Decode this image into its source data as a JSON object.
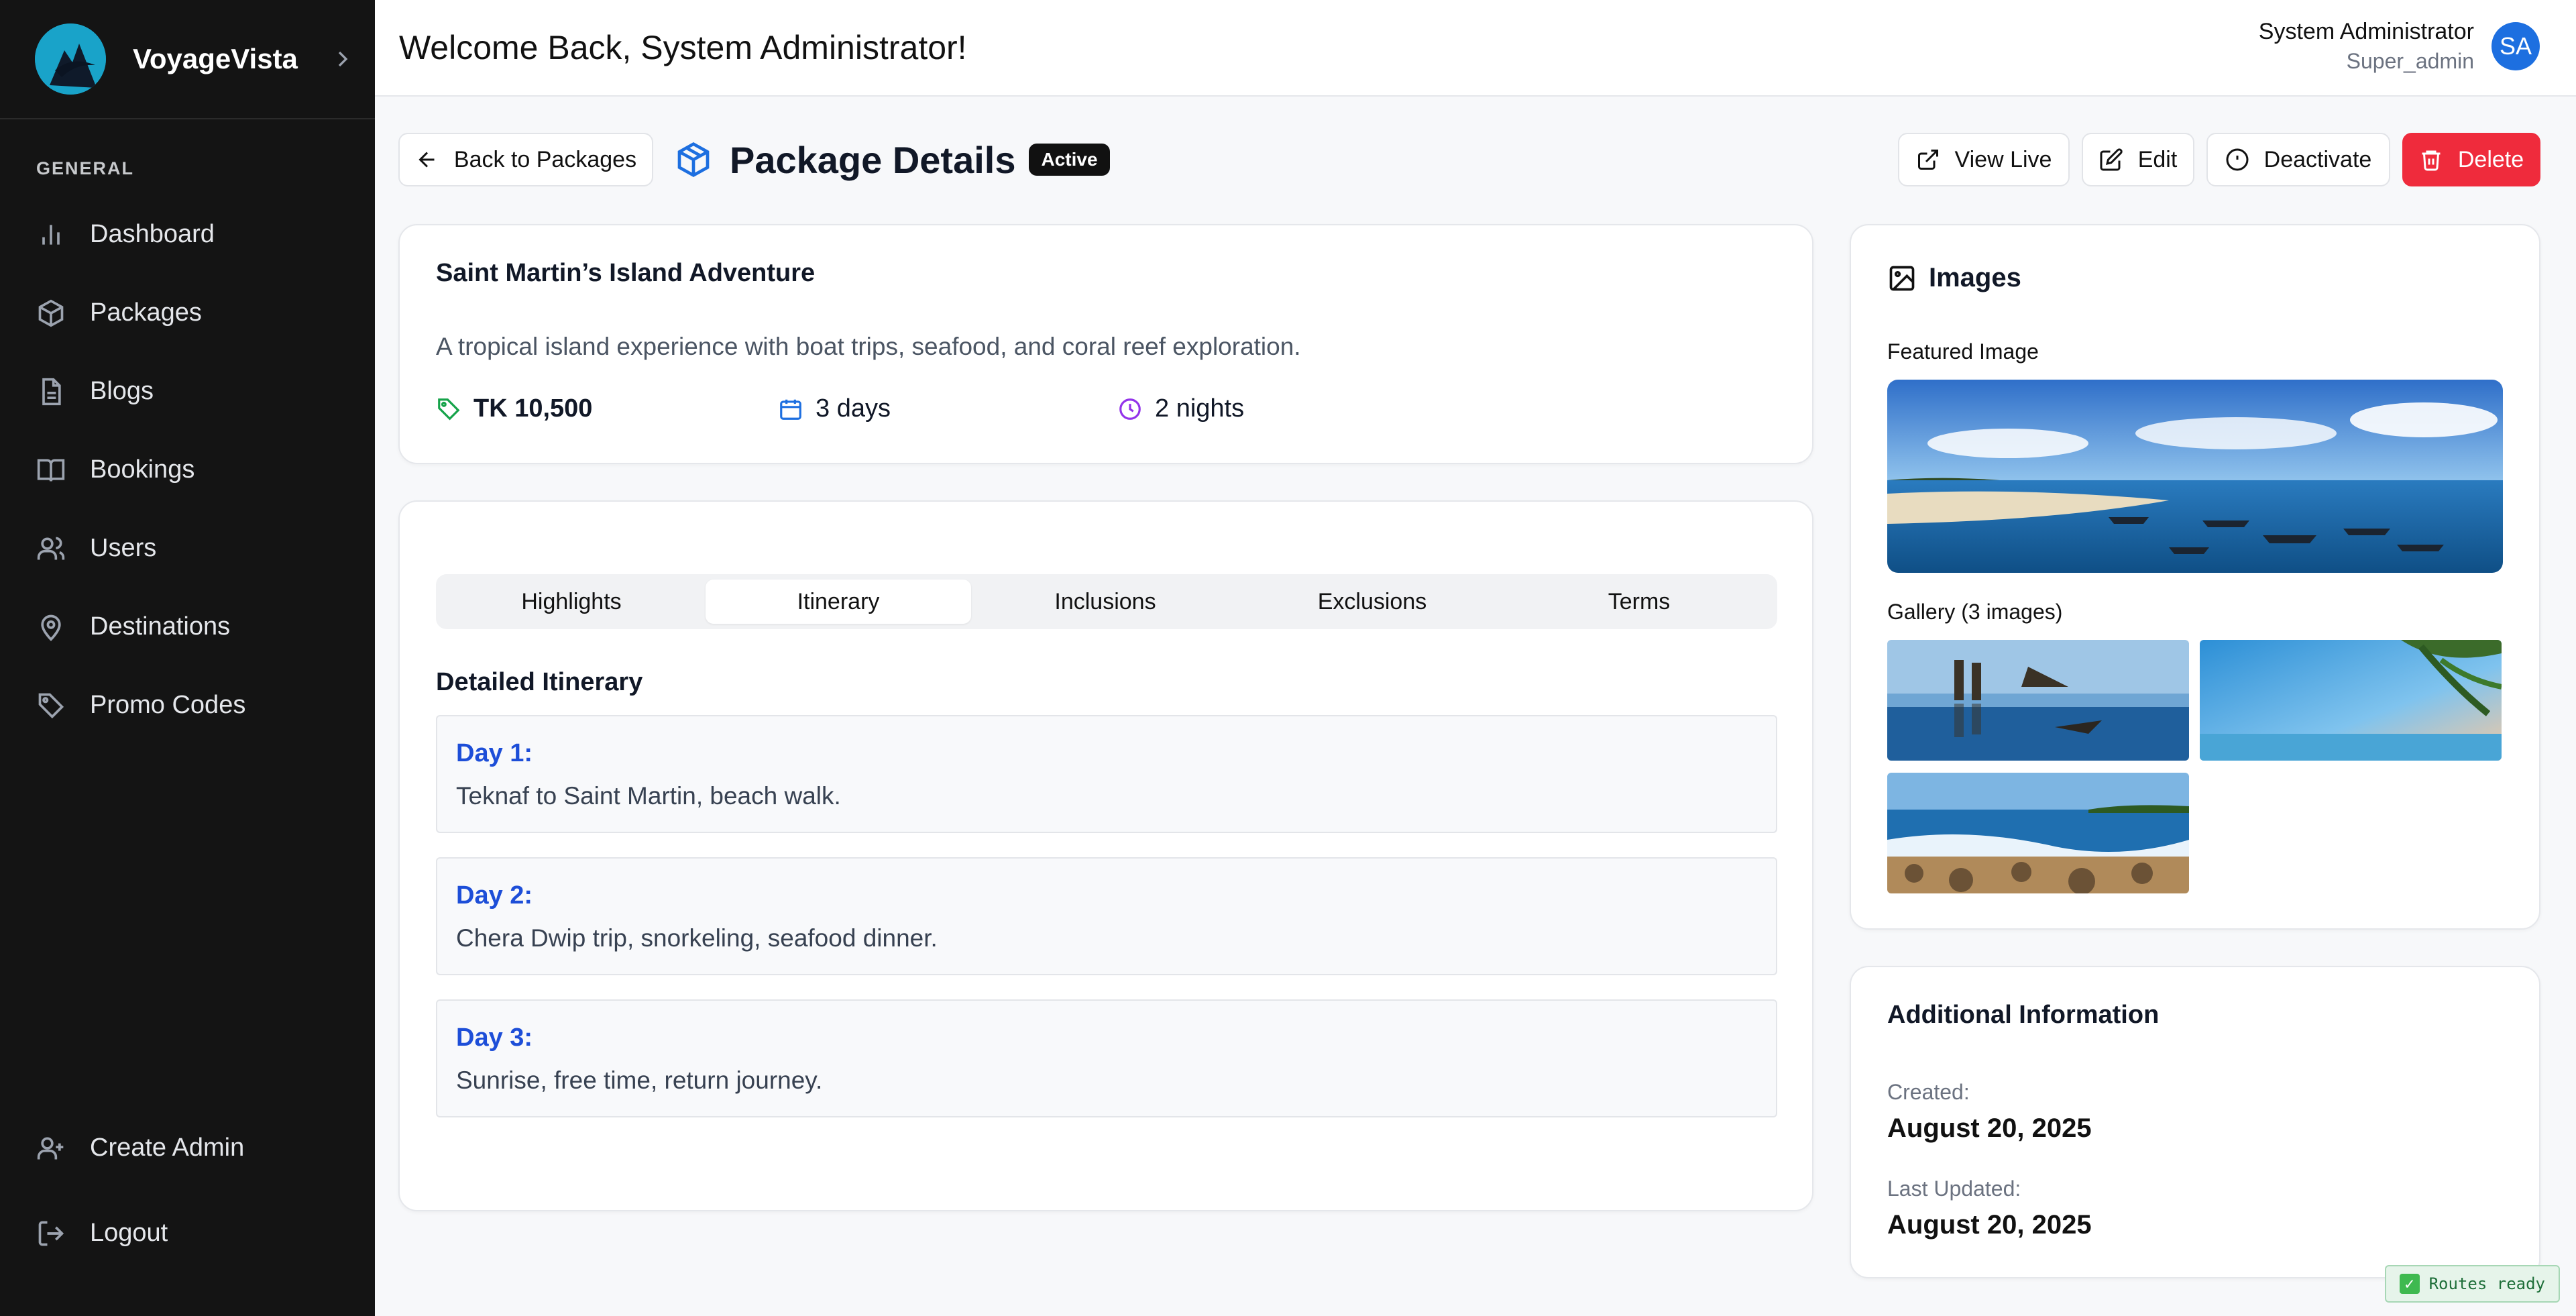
{
  "app": {
    "name": "VoyageVista"
  },
  "sidebar": {
    "section_label": "GENERAL",
    "items": [
      {
        "label": "Dashboard",
        "icon": "bar-chart-icon"
      },
      {
        "label": "Packages",
        "icon": "package-icon"
      },
      {
        "label": "Blogs",
        "icon": "document-icon"
      },
      {
        "label": "Bookings",
        "icon": "book-icon"
      },
      {
        "label": "Users",
        "icon": "users-icon"
      },
      {
        "label": "Destinations",
        "icon": "map-pin-icon"
      },
      {
        "label": "Promo Codes",
        "icon": "tag-icon"
      }
    ],
    "bottom_items": [
      {
        "label": "Create Admin",
        "icon": "user-plus-icon"
      },
      {
        "label": "Logout",
        "icon": "logout-icon"
      }
    ]
  },
  "header": {
    "welcome": "Welcome Back, System Administrator!",
    "user_name": "System Administrator",
    "user_role": "Super_admin",
    "avatar_initials": "SA"
  },
  "toolbar": {
    "back_label": "Back to Packages",
    "page_title": "Package Details",
    "status_badge": "Active",
    "view_live_label": "View Live",
    "edit_label": "Edit",
    "deactivate_label": "Deactivate",
    "delete_label": "Delete"
  },
  "package": {
    "name": "Saint Martin’s Island Adventure",
    "description": "A tropical island experience with boat trips, seafood, and coral reef exploration.",
    "price": "TK 10,500",
    "days": "3 days",
    "nights": "2 nights"
  },
  "tabs": [
    "Highlights",
    "Itinerary",
    "Inclusions",
    "Exclusions",
    "Terms"
  ],
  "active_tab": "Itinerary",
  "itinerary": {
    "title": "Detailed Itinerary",
    "days": [
      {
        "label": "Day 1:",
        "text": "Teknaf to Saint Martin, beach walk."
      },
      {
        "label": "Day 2:",
        "text": "Chera Dwip trip, snorkeling, seafood dinner."
      },
      {
        "label": "Day 3:",
        "text": "Sunrise, free time, return journey."
      }
    ]
  },
  "images": {
    "title": "Images",
    "featured_label": "Featured Image",
    "gallery_label": "Gallery (3 images)"
  },
  "additional": {
    "title": "Additional Information",
    "created_label": "Created:",
    "created_value": "August 20, 2025",
    "updated_label": "Last Updated:",
    "updated_value": "August 20, 2025"
  },
  "toast": {
    "text": "Routes ready"
  },
  "colors": {
    "sidebar": "#141414",
    "accent_blue": "#1d4ed8",
    "delete_red": "#ef2b3c",
    "badge": "#111111"
  }
}
